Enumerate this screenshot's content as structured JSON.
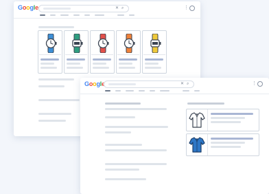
{
  "back_window": {
    "logo": [
      "G",
      "o",
      "o",
      "g",
      "l",
      "e"
    ],
    "tabs_count": 7,
    "products": [
      {
        "name": "blue-analog-watch-icon",
        "strap": "#3d8fd6",
        "kind": "analog"
      },
      {
        "name": "green-digital-watch-icon",
        "strap": "#2f9e80",
        "kind": "digital"
      },
      {
        "name": "red-analog-watch-icon",
        "strap": "#e2504a",
        "kind": "analog"
      },
      {
        "name": "orange-analog-watch-icon",
        "strap": "#f0823a",
        "kind": "analog"
      },
      {
        "name": "yellow-digital-watch-icon",
        "strap": "#efc93a",
        "kind": "digital"
      }
    ]
  },
  "front_window": {
    "logo": [
      "G",
      "o",
      "o",
      "g",
      "l",
      "e"
    ],
    "products": [
      {
        "name": "white-shirt-icon",
        "color": "#ffffff"
      },
      {
        "name": "blue-jacket-icon",
        "color": "#2e77c6"
      }
    ]
  },
  "colors": {
    "logo_blue": "#4285f4",
    "logo_red": "#ea4335",
    "logo_yellow": "#fbbc05",
    "logo_green": "#34a853"
  }
}
